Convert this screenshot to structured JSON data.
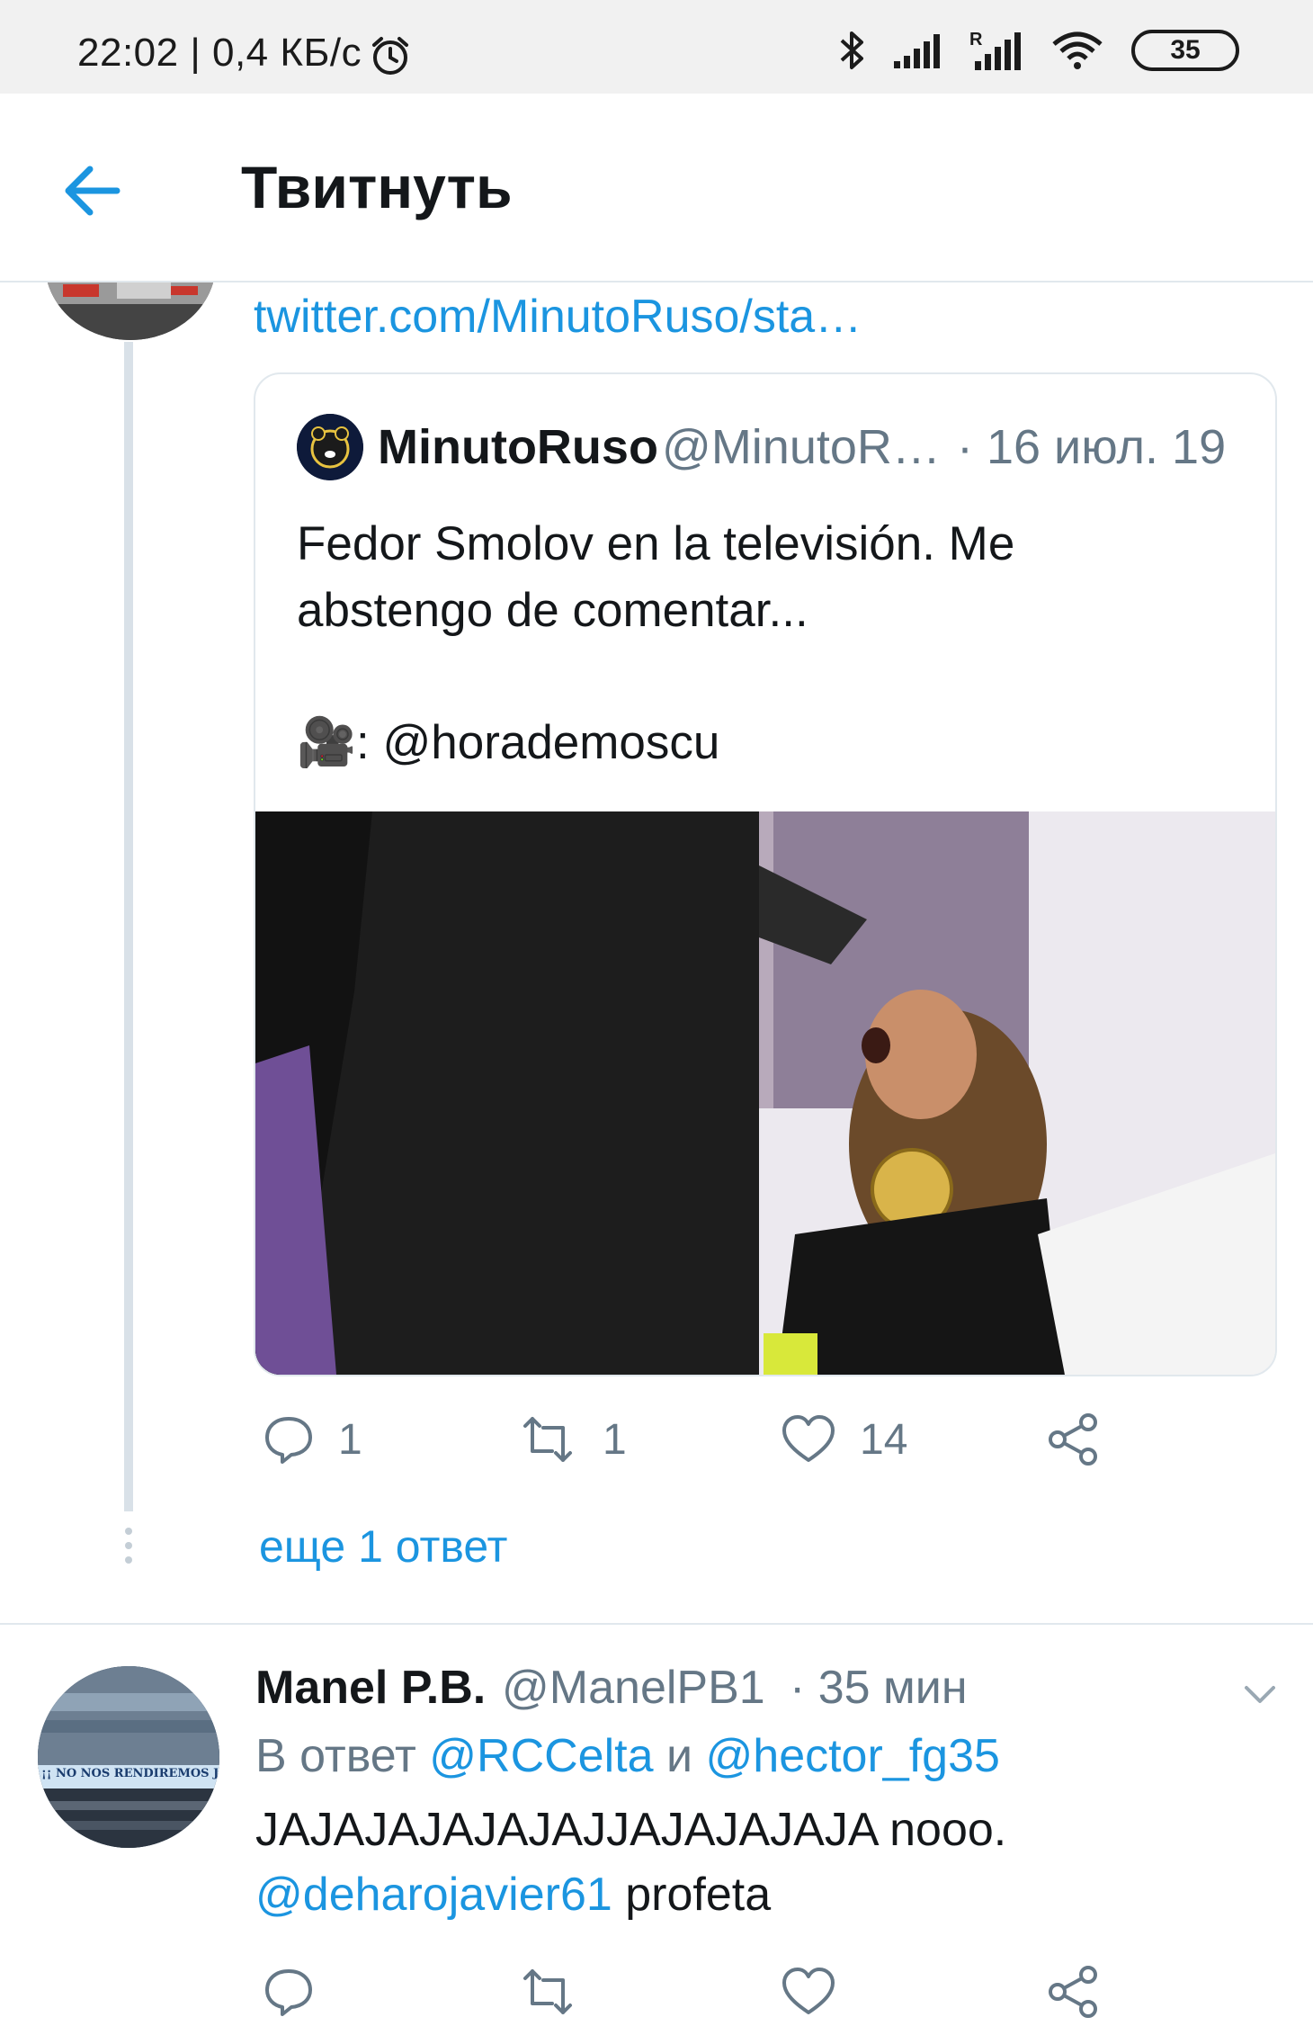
{
  "status_bar": {
    "time": "22:02 | 0,4 КБ/с",
    "battery": "35",
    "icons": [
      "alarm-icon",
      "bluetooth-icon",
      "signal-icon",
      "signal-roaming-icon",
      "wifi-icon",
      "battery-icon"
    ]
  },
  "header": {
    "title": "Твитнуть",
    "back_icon": "arrow-left-icon"
  },
  "thread": {
    "link": "twitter.com/MinutoRuso/sta…",
    "quoted_tweet": {
      "name": "MinutoRuso",
      "handle": "@MinutoR…",
      "date": "· 16 июл. 19",
      "text_line1": "Fedor Smolov en la televisión. Me",
      "text_line2": "abstengo de comentar...",
      "credit_emoji": "🎥",
      "credit_text": ": @horademoscu"
    },
    "actions": {
      "reply_count": "1",
      "retweet_count": "1",
      "like_count": "14"
    },
    "more_replies": "еще 1 ответ"
  },
  "reply": {
    "name": "Manel P.B.",
    "handle": "@ManelPB1",
    "time": "· 35 мин",
    "reply_prefix": "В ответ",
    "mention1": "@RCCelta",
    "conj": "и",
    "mention2": "@hector_fg35",
    "text_line1": "JAJAJAJAJAJAJJAJAJAJAJA nooo.",
    "mention3": "@deharojavier61",
    "text_tail": "profeta",
    "avatar_banner": "¡¡ NO NOS RENDIREMOS JAMÁS"
  },
  "colors": {
    "accent": "#1b95e0",
    "secondary_text": "#657786",
    "divider": "#e1e8ed"
  }
}
